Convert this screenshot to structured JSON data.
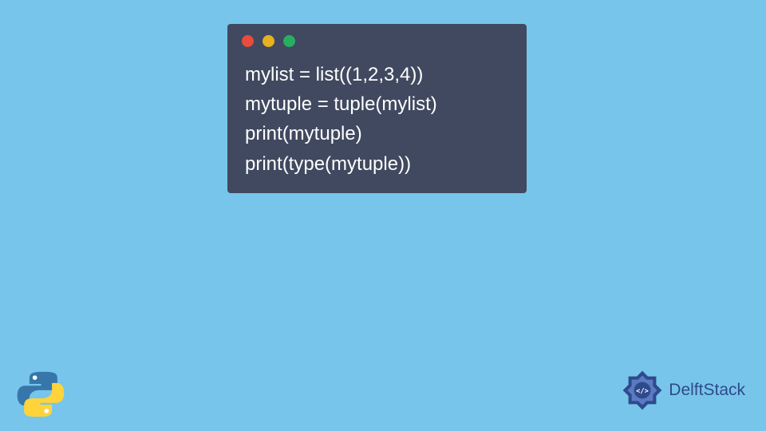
{
  "code": {
    "lines": [
      "mylist = list((1,2,3,4))",
      "mytuple = tuple(mylist)",
      "print(mytuple)",
      "print(type(mytuple))"
    ]
  },
  "branding": {
    "name": "DelftStack"
  }
}
